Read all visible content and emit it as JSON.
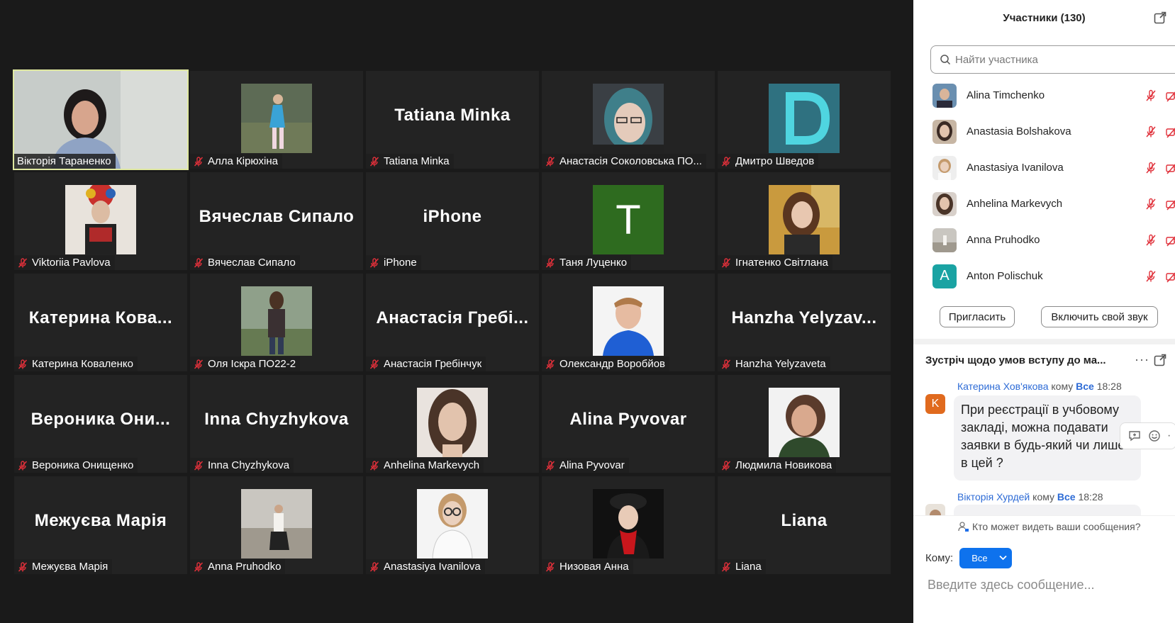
{
  "gallery": {
    "tiles": [
      {
        "type": "video",
        "label": "Вікторія Тараненко",
        "speaking": true
      },
      {
        "type": "photo",
        "label": "Алла Кірюхіна",
        "photo": "girl-field"
      },
      {
        "type": "text",
        "big": "Tatiana Minka",
        "label": "Tatiana Minka"
      },
      {
        "type": "photo",
        "label": "Анастасія Соколовська ПО...",
        "photo": "blue-hair"
      },
      {
        "type": "photo",
        "label": "Дмитро Шведов",
        "photo": "d-logo"
      },
      {
        "type": "photo",
        "label": "Viktoriia Pavlova",
        "photo": "wreath"
      },
      {
        "type": "text",
        "big": "Вячеслав Сипало",
        "label": "Вячеслав Сипало"
      },
      {
        "type": "text",
        "big": "iPhone",
        "label": "iPhone"
      },
      {
        "type": "letter",
        "letter": "T",
        "label": "Таня Луценко"
      },
      {
        "type": "photo",
        "label": "Ігнатенко Світлана",
        "photo": "autumn"
      },
      {
        "type": "text",
        "big": "Катерина Кова...",
        "label": "Катерина Коваленко"
      },
      {
        "type": "photo",
        "label": "Оля Іскра ПО22-2",
        "photo": "girl-park"
      },
      {
        "type": "text",
        "big": "Анастасія Гребі...",
        "label": "Анастасія Гребінчук"
      },
      {
        "type": "photo",
        "label": "Олександр Воробйов",
        "photo": "boy-hoodie"
      },
      {
        "type": "text",
        "big": "Hanzha Yelyzav...",
        "label": "Hanzha Yelyzaveta"
      },
      {
        "type": "text",
        "big": "Вероника Они...",
        "label": "Вероника Онищенко"
      },
      {
        "type": "text",
        "big": "Inna Chyzhykova",
        "label": "Inna Chyzhykova"
      },
      {
        "type": "photo",
        "label": "Anhelina Markevych",
        "photo": "portrait-dark"
      },
      {
        "type": "text",
        "big": "Alina Pyvovar",
        "label": "Alina Pyvovar"
      },
      {
        "type": "photo",
        "label": "Людмила Новикова",
        "photo": "woman-short"
      },
      {
        "type": "text",
        "big": "Межуєва Марія",
        "label": "Межуєва Марія"
      },
      {
        "type": "photo",
        "label": "Anna Pruhodko",
        "photo": "beach"
      },
      {
        "type": "photo",
        "label": "Anastasiya Ivanilova",
        "photo": "glasses"
      },
      {
        "type": "photo",
        "label": "Низовая Анна",
        "photo": "red-scarf"
      },
      {
        "type": "text",
        "big": "Liana",
        "label": "Liana"
      }
    ]
  },
  "panel": {
    "title": "Участники (130)",
    "search_placeholder": "Найти участника",
    "participants": [
      {
        "name": "Alina Timchenko",
        "avatar": "photo"
      },
      {
        "name": "Anastasia Bolshakova",
        "avatar": "photo"
      },
      {
        "name": "Anastasiya Ivanilova",
        "avatar": "photo"
      },
      {
        "name": "Anhelina Markevych",
        "avatar": "photo"
      },
      {
        "name": "Anna Pruhodko",
        "avatar": "photo"
      },
      {
        "name": "Anton Polischuk",
        "avatar": "A"
      }
    ],
    "invite_label": "Пригласить",
    "unmute_label": "Включить свой звук"
  },
  "chat": {
    "title": "Зустріч щодо умов вступу до ма...",
    "more": "···",
    "messages": [
      {
        "sender": "Катерина Хов'якова",
        "to_word": "кому",
        "to": "Все",
        "time": "18:28",
        "avatar": "K",
        "text": "При реєстрації в учбовому закладі, можна подавати заявки в будь-який чи лише в цей ?"
      },
      {
        "sender": "Вікторія Хурдей",
        "to_word": "кому",
        "to": "Все",
        "time": "18:28"
      }
    ],
    "who_can_see": "Кто может видеть ваши сообщения?",
    "to_label": "Кому:",
    "to_value": "Все",
    "input_placeholder": "Введите здесь сообщение..."
  },
  "colors": {
    "speaking_border": "#dfe8a0",
    "accent": "#0e72ed",
    "muted_red": "#e0303a"
  }
}
